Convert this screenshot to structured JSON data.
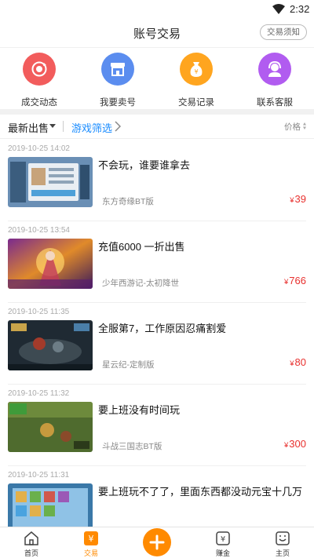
{
  "status_bar": {
    "time": "2:32",
    "wifi_icon": "wifi-icon"
  },
  "header": {
    "title": "账号交易",
    "notice_button": "交易须知"
  },
  "quick_menu": [
    {
      "label": "成交动态",
      "icon": "refresh-coin-icon",
      "color": "#f25c5c"
    },
    {
      "label": "我要卖号",
      "icon": "store-icon",
      "color": "#5b8def"
    },
    {
      "label": "交易记录",
      "icon": "money-bag-icon",
      "color": "#ffa51f"
    },
    {
      "label": "联系客服",
      "icon": "headset-icon",
      "color": "#b15cf0"
    }
  ],
  "filter_bar": {
    "sort_label": "最新出售",
    "game_filter_label": "游戏筛选",
    "price_label": "价格"
  },
  "listings": [
    {
      "date": "2019-10-25 14:02",
      "title": "不会玩，谁要谁拿去",
      "game": "东方奇缘BT版",
      "currency": "¥",
      "price": "39"
    },
    {
      "date": "2019-10-25 13:54",
      "title": "充值6000 一折出售",
      "game": "少年西游记-太初降世",
      "currency": "¥",
      "price": "766"
    },
    {
      "date": "2019-10-25 11:35",
      "title": "全服第7，工作原因忍痛割爱",
      "game": "星云纪-定制版",
      "currency": "¥",
      "price": "80"
    },
    {
      "date": "2019-10-25 11:32",
      "title": "要上班没有时间玩",
      "game": "斗战三国志BT版",
      "currency": "¥",
      "price": "300"
    },
    {
      "date": "2019-10-25 11:31",
      "title": "要上班玩不了了，里面东西都没动元宝十几万",
      "game": "",
      "currency": "",
      "price": ""
    }
  ],
  "tab_bar": {
    "tabs": [
      {
        "label": "首页",
        "icon": "home-icon"
      },
      {
        "label": "交易",
        "icon": "trade-icon",
        "active": true
      },
      {
        "label": "赚金",
        "icon": "earn-icon"
      },
      {
        "label": "主页",
        "icon": "profile-icon"
      }
    ],
    "fab_icon": "plus-icon"
  },
  "colors": {
    "accent": "#ff8a00",
    "price": "#e8302e",
    "link": "#1a8cff"
  }
}
